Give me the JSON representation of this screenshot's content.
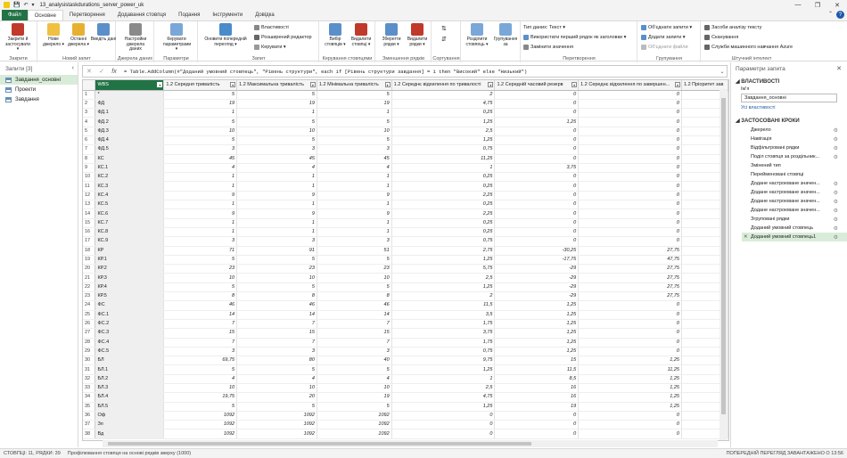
{
  "window": {
    "title": "13_analysistaskdurations_server_power_uk",
    "controls": [
      "—",
      "❐",
      "✕"
    ]
  },
  "tabs": [
    {
      "label": "Файл",
      "kind": "file"
    },
    {
      "label": "Основне",
      "kind": "active"
    },
    {
      "label": "Перетворення",
      "kind": ""
    },
    {
      "label": "Додавання стовпця",
      "kind": ""
    },
    {
      "label": "Подання",
      "kind": ""
    },
    {
      "label": "Інструменти",
      "kind": ""
    },
    {
      "label": "Довідка",
      "kind": ""
    }
  ],
  "ribbon": {
    "groups": [
      {
        "label": "Закрити",
        "buttons": [
          "Закрити й застосувати ▾"
        ]
      },
      {
        "label": "Новий запит",
        "buttons": [
          "Нове джерело ▾",
          "Останні джерела ▾",
          "Введіть дані"
        ]
      },
      {
        "label": "Джерела даних",
        "buttons": [
          "Настройки джерела даних"
        ]
      },
      {
        "label": "Параметри",
        "buttons": [
          "Керувати параметрами ▾"
        ]
      },
      {
        "label": "Запит",
        "buttons": [
          "Оновити попередній перегляд ▾"
        ],
        "small": [
          "Властивості",
          "Розширений редактор",
          "Керувати ▾"
        ]
      },
      {
        "label": "Керування стовпцями",
        "buttons": [
          "Вибір стовпців ▾",
          "Видалити стовпці ▾"
        ]
      },
      {
        "label": "Зменшення рядків",
        "buttons": [
          "Зберегти рядки ▾",
          "Видалити рядки ▾"
        ]
      },
      {
        "label": "Сортування",
        "buttons": []
      },
      {
        "label": "",
        "buttons": [
          "Розділити стовпець ▾",
          "Групування за"
        ]
      },
      {
        "label": "Перетворення",
        "buttons": [],
        "small": [
          "Тип даних: Текст ▾",
          "Використати перший рядок як заголовки ▾",
          "Замінити значення"
        ]
      },
      {
        "label": "Групування",
        "buttons": [],
        "small": [
          "Об'єднати запити ▾",
          "Додати запити ▾",
          "Об'єднати файли"
        ]
      },
      {
        "label": "Штучний інтелект",
        "buttons": [],
        "small": [
          "Засоби аналізу тексту",
          "Сканування",
          "Служби машинного навчання Azure"
        ]
      }
    ]
  },
  "queries": {
    "header": "Запити [3]",
    "items": [
      {
        "label": "Завдання_основні",
        "selected": true
      },
      {
        "label": "Проекти",
        "selected": false
      },
      {
        "label": "Завдання",
        "selected": false
      }
    ]
  },
  "formula": "= Table.AddColumn(#\"Доданий умовний стовпець\", \"Рівень структури\", each if [Рівень структури завдання] = 1 then \"Високий\" else \"Низький\")",
  "grid": {
    "columns": [
      "WBS",
      "1.2 Середня тривалість",
      "1.2 Максимальна тривалість",
      "1.2 Мінімальна тривалість",
      "1.2 Середнє відхилення по тривалості",
      "1.2 Середній часовий резерв",
      "1.2 Середнє відхилення по завершен...",
      "1.2 Пріоритет зав"
    ],
    "rows": [
      [
        "*",
        "5",
        "5",
        "5",
        "2",
        "0",
        "0"
      ],
      [
        "ФД",
        "19",
        "19",
        "19",
        "4,75",
        "0",
        "0"
      ],
      [
        "ФД.1",
        "1",
        "1",
        "1",
        "0,25",
        "0",
        "0"
      ],
      [
        "ФД.2",
        "5",
        "5",
        "5",
        "1,25",
        "1,25",
        "0"
      ],
      [
        "ФД.3",
        "10",
        "10",
        "10",
        "2,5",
        "0",
        "0"
      ],
      [
        "ФД.4",
        "5",
        "5",
        "5",
        "1,25",
        "0",
        "0"
      ],
      [
        "ФД.5",
        "3",
        "3",
        "3",
        "0,75",
        "0",
        "0"
      ],
      [
        "КС",
        "45",
        "45",
        "45",
        "11,25",
        "0",
        "0"
      ],
      [
        "КС.1",
        "4",
        "4",
        "4",
        "1",
        "3,75",
        "0"
      ],
      [
        "КС.2",
        "1",
        "1",
        "1",
        "0,25",
        "0",
        "0"
      ],
      [
        "КС.3",
        "1",
        "1",
        "1",
        "0,25",
        "0",
        "0"
      ],
      [
        "КС.4",
        "9",
        "9",
        "9",
        "2,25",
        "0",
        "0"
      ],
      [
        "КС.5",
        "1",
        "1",
        "1",
        "0,25",
        "0",
        "0"
      ],
      [
        "КС.6",
        "9",
        "9",
        "9",
        "2,25",
        "0",
        "0"
      ],
      [
        "КС.7",
        "1",
        "1",
        "1",
        "0,25",
        "0",
        "0"
      ],
      [
        "КС.8",
        "1",
        "1",
        "1",
        "0,25",
        "0",
        "0"
      ],
      [
        "КС.9",
        "3",
        "3",
        "3",
        "0,75",
        "0",
        "0"
      ],
      [
        "КР",
        "71",
        "91",
        "51",
        "2,75",
        "-30,25",
        "27,75"
      ],
      [
        "КР.1",
        "5",
        "5",
        "5",
        "1,25",
        "-17,75",
        "47,75"
      ],
      [
        "КР.2",
        "23",
        "23",
        "23",
        "5,75",
        "-29",
        "27,75"
      ],
      [
        "КР.3",
        "10",
        "10",
        "10",
        "2,5",
        "-29",
        "27,75"
      ],
      [
        "КР.4",
        "5",
        "5",
        "5",
        "1,25",
        "-29",
        "27,75"
      ],
      [
        "КР.5",
        "8",
        "8",
        "8",
        "2",
        "-29",
        "27,75"
      ],
      [
        "ФС",
        "46",
        "46",
        "46",
        "11,5",
        "1,25",
        "0"
      ],
      [
        "ФС.1",
        "14",
        "14",
        "14",
        "3,5",
        "1,25",
        "0"
      ],
      [
        "ФС.2",
        "7",
        "7",
        "7",
        "1,75",
        "1,25",
        "0"
      ],
      [
        "ФС.3",
        "15",
        "15",
        "15",
        "3,75",
        "1,25",
        "0"
      ],
      [
        "ФС.4",
        "7",
        "7",
        "7",
        "1,75",
        "1,25",
        "0"
      ],
      [
        "ФС.5",
        "3",
        "3",
        "3",
        "0,75",
        "1,25",
        "0"
      ],
      [
        "БЛ",
        "69,75",
        "80",
        "40",
        "9,75",
        "15",
        "1,25"
      ],
      [
        "БЛ.1",
        "5",
        "5",
        "5",
        "1,25",
        "11,5",
        "11,25"
      ],
      [
        "БЛ.2",
        "4",
        "4",
        "4",
        "1",
        "8,5",
        "1,25"
      ],
      [
        "БЛ.3",
        "10",
        "10",
        "10",
        "2,5",
        "16",
        "1,25"
      ],
      [
        "БЛ.4",
        "19,75",
        "20",
        "19",
        "4,75",
        "16",
        "1,25"
      ],
      [
        "БЛ.5",
        "5",
        "5",
        "5",
        "1,25",
        "19",
        "1,25"
      ],
      [
        "Оф",
        "1092",
        "1092",
        "1092",
        "0",
        "0",
        "0"
      ],
      [
        "Зп",
        "1092",
        "1092",
        "1092",
        "0",
        "0",
        "0"
      ],
      [
        "Вд",
        "1092",
        "1092",
        "1092",
        "0",
        "0",
        "0"
      ]
    ]
  },
  "properties": {
    "header": "Параметри запита",
    "section_props": "ВЛАСТИВОСТІ",
    "name_label": "Ім'я",
    "name_value": "Завдання_основні",
    "all_props_link": "Усі властивості",
    "section_steps": "ЗАСТОСОВАНІ КРОКИ",
    "steps": [
      {
        "label": "Джерело",
        "gear": true
      },
      {
        "label": "Навігація",
        "gear": true
      },
      {
        "label": "Відфільтровані рядки",
        "gear": true
      },
      {
        "label": "Поділ стовпця за роздільник...",
        "gear": true
      },
      {
        "label": "Змінений тип",
        "gear": false
      },
      {
        "label": "Перейменовані стовпці",
        "gear": false
      },
      {
        "label": "Додане настроюване значен...",
        "gear": true
      },
      {
        "label": "Додане настроюване значен...",
        "gear": true
      },
      {
        "label": "Додане настроюване значен...",
        "gear": true
      },
      {
        "label": "Додане настроюване значен...",
        "gear": true
      },
      {
        "label": "Згруповані рядки",
        "gear": true
      },
      {
        "label": "Доданий умовний стовпець",
        "gear": true
      },
      {
        "label": "Доданий умовний стовпець1",
        "gear": true,
        "selected": true
      }
    ]
  },
  "status": {
    "left1": "СТОВПЦІ: 11, РЯДКИ: 39",
    "left2": "Профілювання стовпця на основі рядків зверху (1000)",
    "right": "ПОПЕРЕДНІЙ ПЕРЕГЛЯД ЗАВАНТАЖЕНО О 13:56"
  },
  "colors": {
    "accent": "#217346",
    "selected_bg": "#d9ecd9",
    "link": "#1e5aa8"
  }
}
